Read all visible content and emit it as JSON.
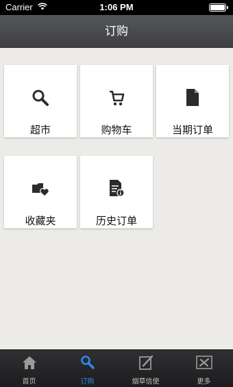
{
  "status_bar": {
    "carrier": "Carrier",
    "time": "1:06 PM",
    "icons": [
      "wifi-icon",
      "battery-icon"
    ]
  },
  "nav": {
    "title": "订购"
  },
  "tiles": [
    {
      "label": "超市",
      "icon": "search-icon"
    },
    {
      "label": "购物车",
      "icon": "shopping-cart-icon"
    },
    {
      "label": "当期订单",
      "icon": "document-icon"
    },
    {
      "label": "收藏夹",
      "icon": "favorites-icon"
    },
    {
      "label": "历史订单",
      "icon": "order-history-icon"
    }
  ],
  "tab_bar": {
    "active_color": "#2d8cf0",
    "tabs": [
      {
        "label": "首页",
        "icon": "home-icon",
        "active": false
      },
      {
        "label": "订购",
        "icon": "search-icon",
        "active": true
      },
      {
        "label": "烟草信使",
        "icon": "edit-icon",
        "active": false
      },
      {
        "label": "更多",
        "icon": "tools-icon",
        "active": false
      }
    ]
  }
}
